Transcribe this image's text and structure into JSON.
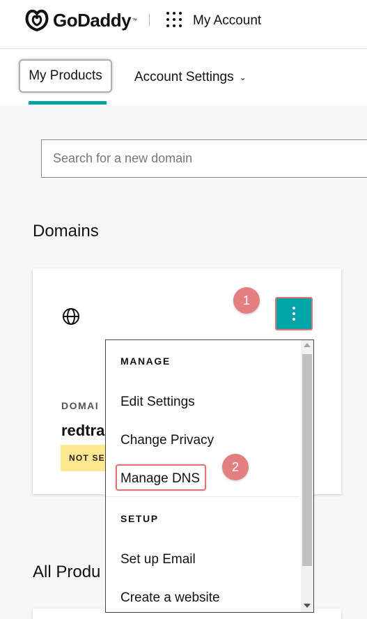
{
  "header": {
    "brand": "GoDaddy",
    "trademark": "™",
    "account_label": "My Account"
  },
  "nav": {
    "tabs": [
      {
        "label": "My Products",
        "active": true
      },
      {
        "label": "Account Settings",
        "has_dropdown": true
      }
    ]
  },
  "search": {
    "placeholder": "Search for a new domain"
  },
  "domains": {
    "heading": "Domains",
    "card": {
      "label": "DOMAI",
      "domain": "redtra",
      "badge": "NOT SE"
    }
  },
  "all_products": {
    "heading": "All Produ"
  },
  "menu": {
    "sections": [
      {
        "title": "MANAGE",
        "items": [
          "Edit Settings",
          "Change Privacy",
          "Manage DNS"
        ]
      },
      {
        "title": "SETUP",
        "items": [
          "Set up Email",
          "Create a website"
        ]
      }
    ]
  },
  "steps": [
    "1",
    "2"
  ],
  "colors": {
    "accent": "#00a4a6",
    "highlight": "#e07373",
    "badge": "#ffe88f"
  }
}
